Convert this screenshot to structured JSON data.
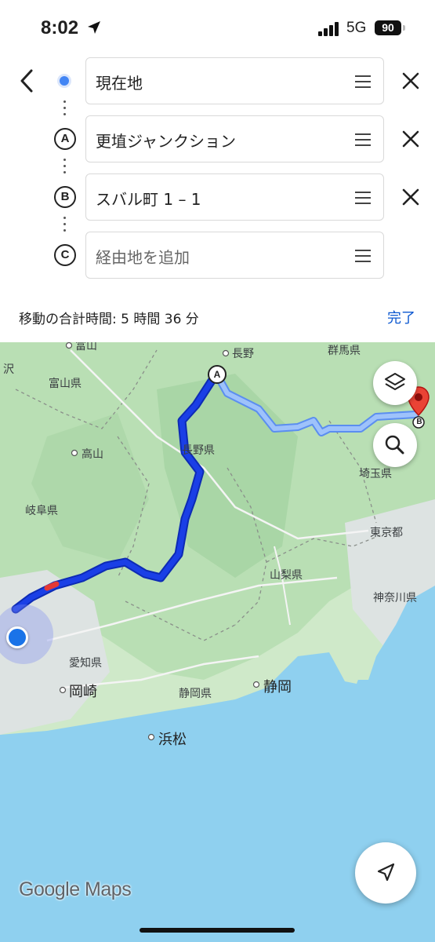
{
  "status_bar": {
    "time": "8:02",
    "network": "5G",
    "battery": "90"
  },
  "route": {
    "stops": [
      {
        "marker": "",
        "text": "現在地",
        "removable": true
      },
      {
        "marker": "A",
        "text": "更埴ジャンクション",
        "removable": true
      },
      {
        "marker": "B",
        "text": "スバル町 1 – 1",
        "removable": true
      },
      {
        "marker": "C",
        "placeholder": "経由地を追加",
        "removable": false
      }
    ],
    "total_time": "移動の合計時間: 5 時間 36 分",
    "done_label": "完了"
  },
  "map": {
    "labels": {
      "toyama_city": "富山",
      "toyama_pref": "富山県",
      "takayama": "高山",
      "gifu_pref": "岐阜県",
      "nagano_city": "長野",
      "nagano_pref": "長野県",
      "gunma_pref": "群馬県",
      "saitama_pref": "埼玉県",
      "tokyo": "東京都",
      "yamanashi_pref": "山梨県",
      "kanagawa_pref": "神奈川県",
      "aichi_pref": "愛知県",
      "okazaki": "岡崎",
      "shizuoka_pref": "静岡県",
      "shizuoka_city": "静岡",
      "hamamatsu": "浜松",
      "edge_left": "沢"
    },
    "marker_a": "A",
    "marker_b": "B",
    "logo": "Google Maps",
    "colors": {
      "route_primary": "#1a3fe6",
      "route_alt": "#8ab4f8",
      "water": "#8fd0ef",
      "forest": "#b8e0b6",
      "destination_pin": "#ea4335"
    }
  }
}
